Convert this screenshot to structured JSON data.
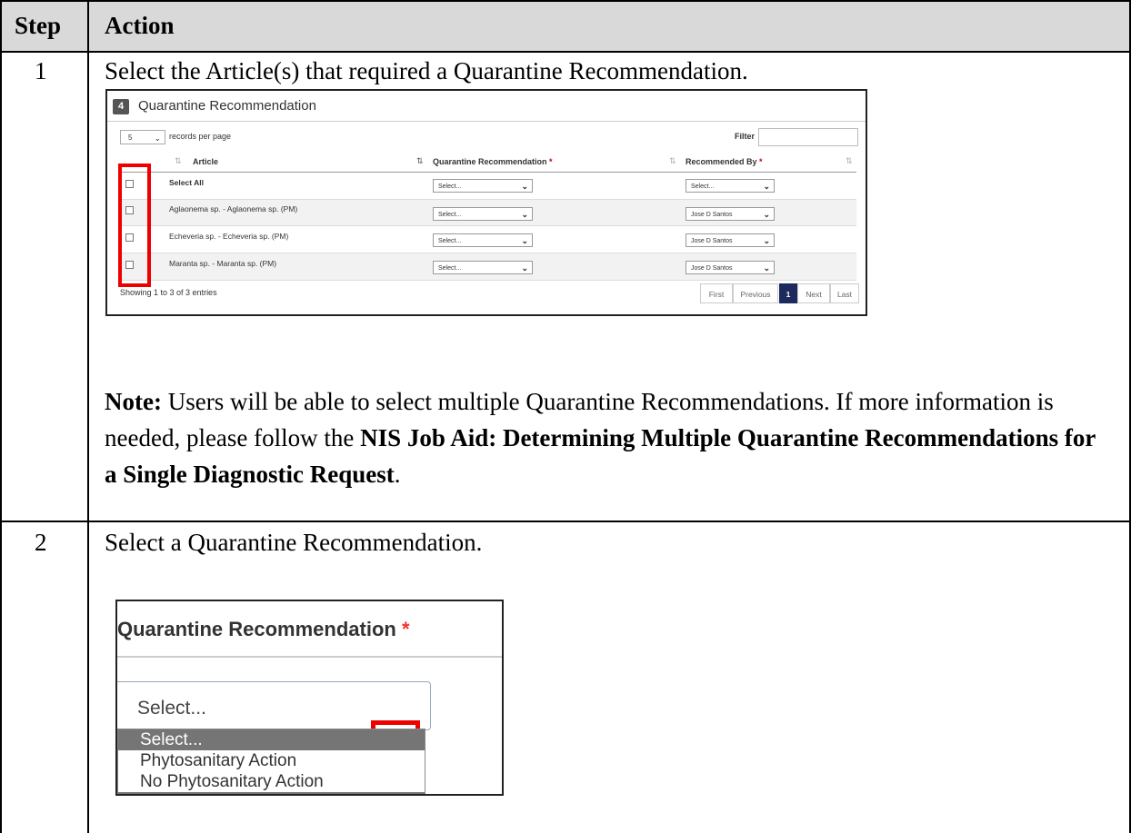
{
  "table": {
    "headers": {
      "step": "Step",
      "action": "Action"
    },
    "rows": [
      {
        "step": "1",
        "action": "Select the Article(s) that required a Quarantine Recommendation.",
        "note": {
          "label": "Note:",
          "text1": " Users will be able to select multiple Quarantine Recommendations. If more information is needed, please follow the ",
          "link": "NIS Job Aid: Determining Multiple Quarantine Recommendations for a Single Diagnostic Request",
          "text2": "."
        }
      },
      {
        "step": "2",
        "action": "Select a Quarantine Recommendation."
      }
    ]
  },
  "screenshot1": {
    "section_number": "4",
    "section_title": "Quarantine Recommendation",
    "page_size": "5",
    "records_per_page": "records per page",
    "filter_label": "Filter",
    "columns": {
      "article": "Article",
      "recommendation": "Quarantine Recommendation",
      "recommended_by": "Recommended By",
      "required_mark": "*"
    },
    "rows": [
      {
        "article": "Select All",
        "recommendation": "Select...",
        "recommended_by": "Select..."
      },
      {
        "article": "Aglaonema sp. - Aglaonema sp. (PM)",
        "recommendation": "Select...",
        "recommended_by": "Jose D Santos"
      },
      {
        "article": "Echeveria sp. - Echeveria sp. (PM)",
        "recommendation": "Select...",
        "recommended_by": "Jose D Santos"
      },
      {
        "article": "Maranta sp. - Maranta sp. (PM)",
        "recommendation": "Select...",
        "recommended_by": "Jose D Santos"
      }
    ],
    "showing": "Showing 1 to 3 of 3 entries",
    "pager": {
      "first": "First",
      "previous": "Previous",
      "current": "1",
      "next": "Next",
      "last": "Last"
    }
  },
  "screenshot2": {
    "header": "Quarantine Recommendation",
    "required_mark": "*",
    "selected_value": "Select...",
    "options": [
      "Select...",
      "Phytosanitary Action",
      "No Phytosanitary Action"
    ]
  },
  "colors": {
    "header_bg": "#d9d9d9",
    "highlight": "#e00000",
    "pager_active": "#1c2a5e"
  }
}
